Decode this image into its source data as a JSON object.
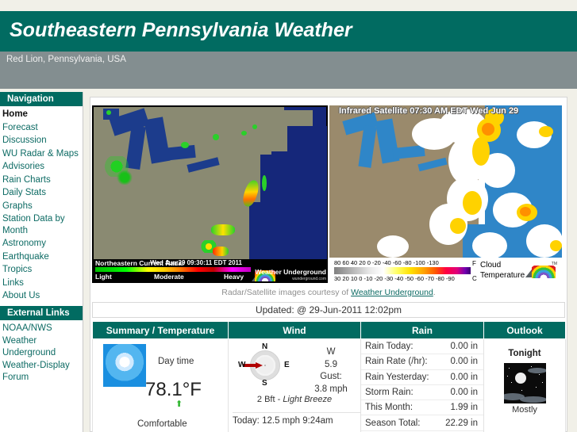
{
  "site": {
    "title": "Southeastern Pennsylvania Weather",
    "location": "Red Lion, Pennsylvania, USA"
  },
  "sidebar": {
    "nav_heading": "Navigation",
    "nav_items": [
      {
        "label": "Home",
        "current": true
      },
      {
        "label": "Forecast",
        "current": false
      },
      {
        "label": "Discussion",
        "current": false
      },
      {
        "label": "WU Radar & Maps",
        "current": false
      },
      {
        "label": "Advisories",
        "current": false
      },
      {
        "label": "Rain Charts",
        "current": false
      },
      {
        "label": "Daily Stats",
        "current": false
      },
      {
        "label": "Graphs",
        "current": false
      },
      {
        "label": "Station Data by Month",
        "current": false
      },
      {
        "label": "Astronomy",
        "current": false
      },
      {
        "label": "Earthquake",
        "current": false
      },
      {
        "label": "Tropics",
        "current": false
      },
      {
        "label": "Links",
        "current": false
      },
      {
        "label": "About Us",
        "current": false
      }
    ],
    "external_heading": "External Links",
    "external_items": [
      {
        "label": "NOAA/NWS"
      },
      {
        "label": "Weather Underground"
      },
      {
        "label": "Weather-Display Forum"
      }
    ]
  },
  "radar": {
    "title": "Northeastern Current Radar",
    "timestamp": "Wed Jun 29 09:30:11 EDT 2011",
    "legend_light": "Light",
    "legend_moderate": "Moderate",
    "legend_heavy": "Heavy",
    "brand": "Weather Underground",
    "brand_sub": "wunderground.com"
  },
  "satellite": {
    "title": "Infrared Satellite 07:30 AM EDT Wed Jun 29",
    "scale_f": "80  60  40  20   0  -20 -40 -60 -80 -100  -130",
    "scale_c": "30  20  10   0  -10 -20 -30 -40 -50 -60 -70 -80 -90",
    "unit_f": "F",
    "unit_c": "C",
    "caption_line1": "Cloud",
    "caption_line2": "Temperature"
  },
  "courtesy": {
    "prefix": "Radar/Satellite images courtesy of ",
    "link": "Weather Underground",
    "suffix": "."
  },
  "updated": "Updated: @ 29-Jun-2011 12:02pm",
  "table": {
    "headers": [
      "Summary / Temperature",
      "Wind",
      "Rain",
      "Outlook"
    ],
    "summary": {
      "icon": "sun-icon",
      "period": "Day time",
      "temperature": "78.1°F",
      "trend_icon": "arrow-up-icon",
      "comfort": "Comfortable"
    },
    "wind": {
      "compass_n": "N",
      "compass_e": "E",
      "compass_s": "S",
      "compass_w": "W",
      "direction": "W",
      "speed": "5.9",
      "gust_label": "Gust:",
      "gust": "3.8 mph",
      "beaufort": "2 Bft - ",
      "beaufort_desc": "Light Breeze",
      "today": "Today: 12.5 mph 9:24am"
    },
    "rain": [
      {
        "label": "Rain Today:",
        "value": "0.00 in"
      },
      {
        "label": "Rain Rate (/hr):",
        "value": "0.00 in"
      },
      {
        "label": "Rain Yesterday:",
        "value": "0.00 in"
      },
      {
        "label": "Storm Rain:",
        "value": "0.00 in"
      },
      {
        "label": "This Month:",
        "value": "1.99 in"
      },
      {
        "label": "Season Total:",
        "value": "22.29 in"
      }
    ],
    "outlook": {
      "title": "Tonight",
      "icon": "night-sky-icon",
      "text": "Mostly"
    }
  },
  "colors": {
    "teal": "#016b61",
    "gray_band": "#838e90",
    "page_bg": "#f1f0e8",
    "link": "#0d6b64"
  }
}
